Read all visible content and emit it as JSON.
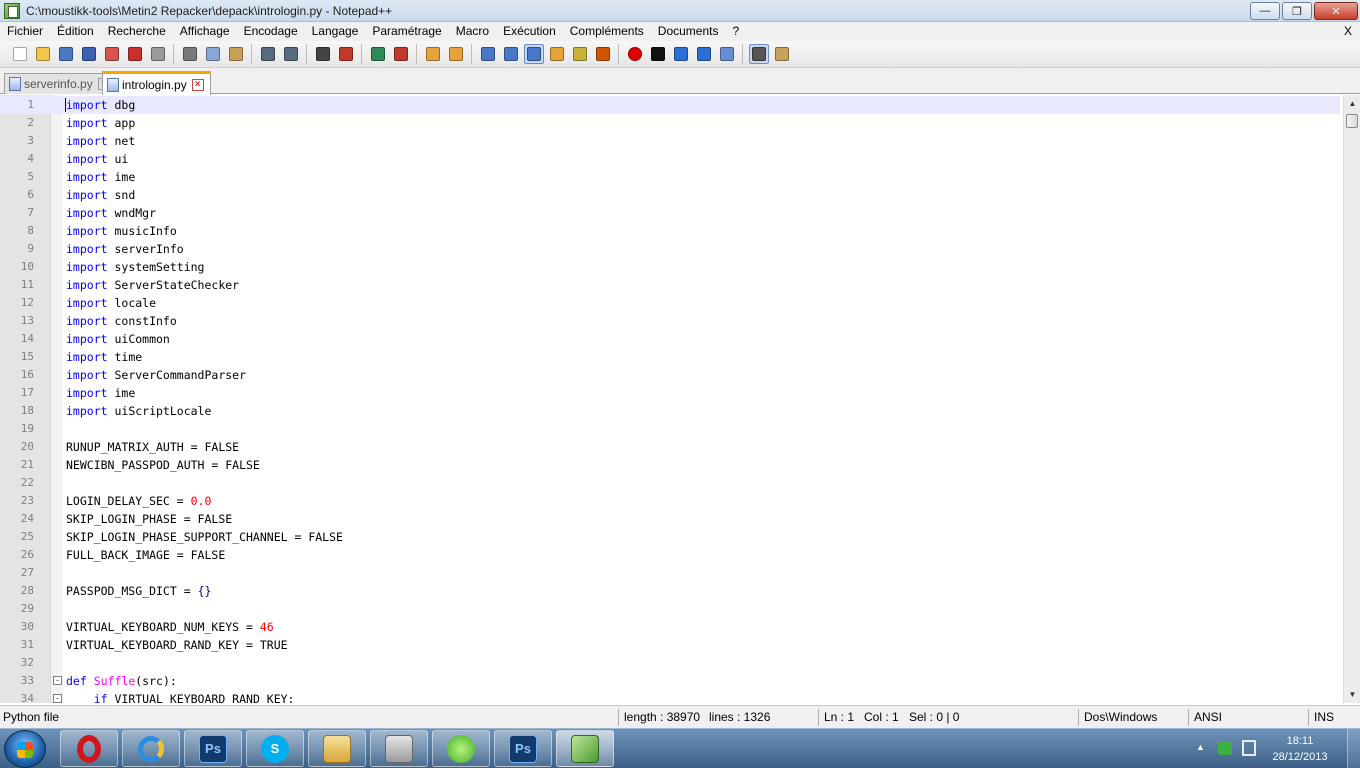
{
  "window": {
    "title": "C:\\moustikk-tools\\Metin2 Repacker\\depack\\intrologin.py - Notepad++",
    "min": "0",
    "max": "1",
    "close": "r"
  },
  "menu": {
    "items": [
      "Fichier",
      "Édition",
      "Recherche",
      "Affichage",
      "Encodage",
      "Langage",
      "Paramétrage",
      "Macro",
      "Exécution",
      "Compléments",
      "Documents",
      "?"
    ],
    "close_label": "X"
  },
  "toolbar": {
    "buttons": [
      "new-file-icon",
      "open-file-icon",
      "save-icon",
      "save-all-icon",
      "close-icon",
      "close-all-icon",
      "print-icon",
      "cut-icon",
      "copy-icon",
      "paste-icon",
      "undo-icon",
      "redo-icon",
      "find-icon",
      "replace-icon",
      "zoom-in-icon",
      "zoom-out-icon",
      "sync-vertical-icon",
      "sync-horizontal-icon",
      "word-wrap-icon",
      "show-all-characters-icon",
      "indent-guide-icon",
      "user-language-icon",
      "document-map-icon",
      "function-list-icon",
      "record-macro-icon",
      "stop-macro-icon",
      "play-macro-icon",
      "run-macro-multiple-icon",
      "save-macro-icon",
      "spell-check-icon",
      "plugin-icon"
    ]
  },
  "tabs": [
    {
      "label": "serverinfo.py",
      "active": false
    },
    {
      "label": "intrologin.py",
      "active": true
    }
  ],
  "editor": {
    "lines": [
      {
        "n": "1",
        "kw": "import",
        "rest": " dbg"
      },
      {
        "n": "2",
        "kw": "import",
        "rest": " app"
      },
      {
        "n": "3",
        "kw": "import",
        "rest": " net"
      },
      {
        "n": "4",
        "kw": "import",
        "rest": " ui"
      },
      {
        "n": "5",
        "kw": "import",
        "rest": " ime"
      },
      {
        "n": "6",
        "kw": "import",
        "rest": " snd"
      },
      {
        "n": "7",
        "kw": "import",
        "rest": " wndMgr"
      },
      {
        "n": "8",
        "kw": "import",
        "rest": " musicInfo"
      },
      {
        "n": "9",
        "kw": "import",
        "rest": " serverInfo"
      },
      {
        "n": "10",
        "kw": "import",
        "rest": " systemSetting"
      },
      {
        "n": "11",
        "kw": "import",
        "rest": " ServerStateChecker"
      },
      {
        "n": "12",
        "kw": "import",
        "rest": " locale"
      },
      {
        "n": "13",
        "kw": "import",
        "rest": " constInfo"
      },
      {
        "n": "14",
        "kw": "import",
        "rest": " uiCommon"
      },
      {
        "n": "15",
        "kw": "import",
        "rest": " time"
      },
      {
        "n": "16",
        "kw": "import",
        "rest": " ServerCommandParser"
      },
      {
        "n": "17",
        "kw": "import",
        "rest": " ime"
      },
      {
        "n": "18",
        "kw": "import",
        "rest": " uiScriptLocale"
      },
      {
        "n": "19",
        "text": ""
      },
      {
        "n": "20",
        "text": "RUNUP_MATRIX_AUTH = FALSE"
      },
      {
        "n": "21",
        "text": "NEWCIBN_PASSPOD_AUTH = FALSE"
      },
      {
        "n": "22",
        "text": ""
      },
      {
        "n": "23",
        "text": "LOGIN_DELAY_SEC = ",
        "num": "0.0"
      },
      {
        "n": "24",
        "text": "SKIP_LOGIN_PHASE = FALSE"
      },
      {
        "n": "25",
        "text": "SKIP_LOGIN_PHASE_SUPPORT_CHANNEL = FALSE"
      },
      {
        "n": "26",
        "text": "FULL_BACK_IMAGE = FALSE"
      },
      {
        "n": "27",
        "text": ""
      },
      {
        "n": "28",
        "text": "PASSPOD_MSG_DICT = ",
        "op": "{}"
      },
      {
        "n": "29",
        "text": ""
      },
      {
        "n": "30",
        "text": "VIRTUAL_KEYBOARD_NUM_KEYS = ",
        "num": "46"
      },
      {
        "n": "31",
        "text": "VIRTUAL_KEYBOARD_RAND_KEY = TRUE"
      },
      {
        "n": "32",
        "text": ""
      },
      {
        "n": "33",
        "kw": "def",
        "fn": " Suffle",
        "rest": "(src):",
        "fold": true
      },
      {
        "n": "34",
        "indentkw": "    if",
        "rest": " VIRTUAL_KEYBOARD_RAND_KEY:",
        "fold": true
      }
    ]
  },
  "status": {
    "language": "Python file",
    "length": "length : 38970",
    "lines": "lines : 1326",
    "ln": "Ln : 1",
    "col": "Col : 1",
    "sel": "Sel : 0 | 0",
    "eol": "Dos\\Windows",
    "encoding": "ANSI",
    "mode": "INS"
  },
  "taskbar": {
    "apps": [
      "opera-icon",
      "internet-explorer-icon",
      "photoshop-icon",
      "skype-icon",
      "file-explorer-icon",
      "computer-icon",
      "browser-icon",
      "photoshop-icon",
      "notepad-plus-plus-icon"
    ],
    "ps_label": "Ps",
    "time": "18:11",
    "date": "28/12/2013"
  },
  "colors": {
    "keyword": "#0000ff",
    "number": "#ff0000",
    "function": "#ff00ff",
    "current_line": "#e8e8ff",
    "tab_accent": "#f6a800"
  }
}
